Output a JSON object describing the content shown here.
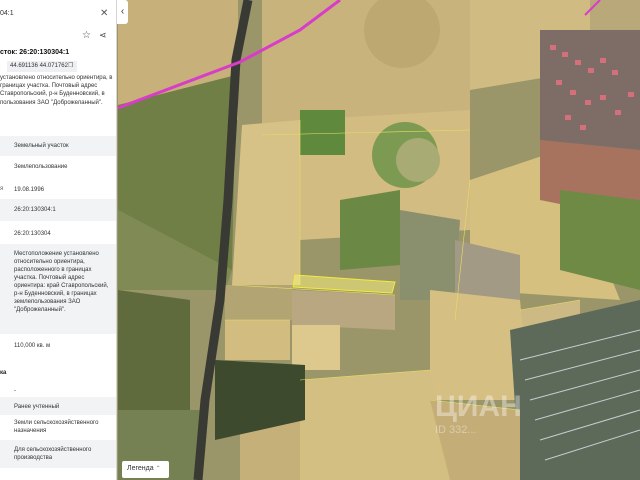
{
  "panel": {
    "header_id": "04:1",
    "title": "сток: 26:20:130304:1",
    "coords": "44.691136 44.071762",
    "description": "установлено относительно ориентира, в границах участка. Почтовый адрес Ставропольский, р-н Буденновский, в пользования ЗАО \"Доброжеланный\".",
    "fields": [
      {
        "label": "",
        "value": "Земельный участок"
      },
      {
        "label": "",
        "value": "Землепользование"
      },
      {
        "label": "я",
        "value": "19.08.1996"
      },
      {
        "label": "",
        "value": "26:20:130304:1"
      },
      {
        "label": "",
        "value": "26:20:130304"
      },
      {
        "label": "",
        "value": "Местоположение установлено относительно ориентира, расположенного в границах участка. Почтовый адрес ориентира: край Ставропольский, р-н Буденновский, в границах землепользования ЗАО \"Доброжеланный\"."
      },
      {
        "label": "",
        "value": "110,000 кв. м"
      }
    ],
    "section2": "ка",
    "dash": "-",
    "fields2": [
      {
        "value": "Ранее учтенный"
      },
      {
        "value": "Земли сельскохозяйственного назначения"
      },
      {
        "value": "Для сельскохозяйственного производства"
      }
    ]
  },
  "map": {
    "legend_label": "Легенда",
    "watermark_main": "ЦИАН",
    "watermark_sub": "ID 332..."
  },
  "icons": {
    "close": "close-icon",
    "star": "star-icon",
    "share": "share-icon",
    "copy": "copy-icon",
    "collapse": "chevron-left-icon",
    "legend": "chevron-up-icon"
  }
}
